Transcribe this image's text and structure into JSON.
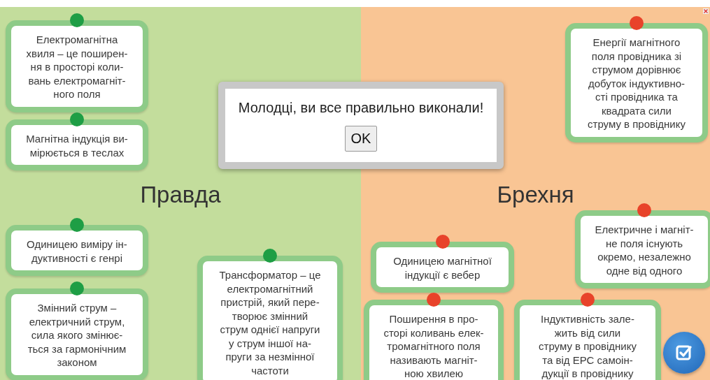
{
  "columns": [
    {
      "title": "Правда",
      "kind": "truth"
    },
    {
      "title": "Брехня",
      "kind": "lie"
    }
  ],
  "cards": [
    {
      "text": "Електромагнітна\nхвиля – це поширен-\nня в просторі коли-\nвань електромагніт-\nного поля",
      "color": "#1e9e45"
    },
    {
      "text": "Магнітна індукція ви-\nмірюється в теслах",
      "color": "#1e9e45"
    },
    {
      "text": "Одиницею виміру ін-\nдуктивності є генрі",
      "color": "#1e9e45"
    },
    {
      "text": "Змінний струм –\nелектричний струм,\nсила якого змінює-\nться за гармонічним\nзаконом",
      "color": "#1e9e45"
    },
    {
      "text": "Трансформатор – це\nелектромагнітний\nпристрій, який пере-\nтворює змінний\nструм однієї напруги\nу струм іншої на-\nпруги за незмінної\nчастоти",
      "color": "#1e9e45"
    },
    {
      "text": "Енергії магнітного\nполя провідника зі\nструмом дорівнює\nдобуток індуктивно-\nсті провідника та\nквадрата сили\nструму в провіднику",
      "color": "#e8432a"
    },
    {
      "text": "Одиницею магнітної\nіндукції є вебер",
      "color": "#e8432a"
    },
    {
      "text": "Електричне і магніт-\nне поля існують\nокремо, незалежно\nодне від одного",
      "color": "#e8432a"
    },
    {
      "text": "Поширення в про-\nсторі коливань елек-\nтромагнітного поля\nназивають магніт-\nною хвилею",
      "color": "#e8432a"
    },
    {
      "text": "Індуктивність зале-\nжить від сили\nструму в провіднику\nта від ЕРС самоін-\nдукції в провіднику",
      "color": "#e8432a"
    }
  ],
  "dialog": {
    "message": "Молодці, ви все правильно виконали!",
    "button": "OK"
  }
}
